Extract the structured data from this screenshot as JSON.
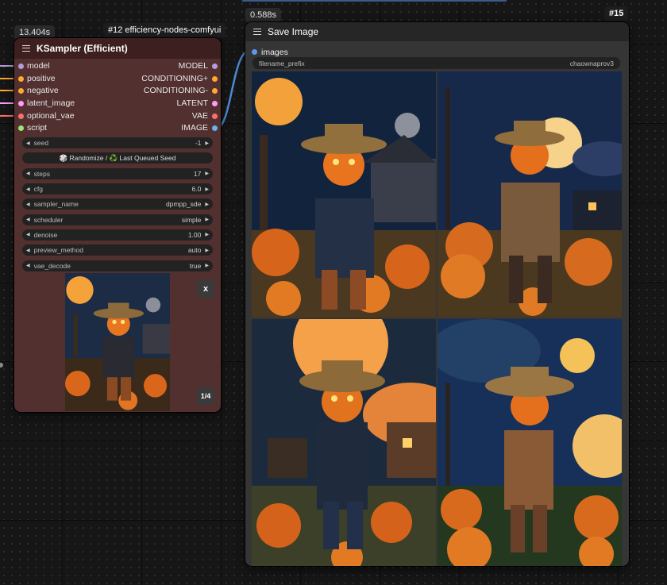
{
  "ksampler": {
    "timing": "13.404s",
    "badge": "#12 efficiency-nodes-comfyui",
    "title": "KSampler (Efficient)",
    "io": [
      {
        "in": "model",
        "out": "MODEL",
        "in_color": "#b39ddb",
        "out_color": "#b39ddb"
      },
      {
        "in": "positive",
        "out": "CONDITIONING+",
        "in_color": "#ffa931",
        "out_color": "#ffa931"
      },
      {
        "in": "negative",
        "out": "CONDITIONING-",
        "in_color": "#ffa931",
        "out_color": "#ffa931"
      },
      {
        "in": "latent_image",
        "out": "LATENT",
        "in_color": "#ff9cf9",
        "out_color": "#ff9cf9"
      },
      {
        "in": "optional_vae",
        "out": "VAE",
        "in_color": "#ff6e6e",
        "out_color": "#ff6e6e"
      },
      {
        "in": "script",
        "out": "IMAGE",
        "in_color": "#9ae66e",
        "out_color": "#64b5f6"
      }
    ],
    "widgets": [
      {
        "label": "seed",
        "value": "-1"
      },
      {
        "label": "steps",
        "value": "17"
      },
      {
        "label": "cfg",
        "value": "6.0"
      },
      {
        "label": "sampler_name",
        "value": "dpmpp_sde"
      },
      {
        "label": "scheduler",
        "value": "simple"
      },
      {
        "label": "denoise",
        "value": "1.00"
      },
      {
        "label": "preview_method",
        "value": "auto"
      },
      {
        "label": "vae_decode",
        "value": "true"
      }
    ],
    "randomize_label": "🎲 Randomize / ♻️ Last Queued Seed",
    "close_label": "x",
    "page_label": "1/4"
  },
  "save": {
    "timing": "0.588s",
    "badge": "#15",
    "title": "Save Image",
    "input_label": "images",
    "prefix_label": "filename_prefix",
    "prefix_value": "chaownaprov3"
  },
  "colors": {
    "ksampler_body": "#533030",
    "ksampler_title": "#3d1f1f",
    "link": "#4f8bd6",
    "image_out": "#64b5f6"
  }
}
